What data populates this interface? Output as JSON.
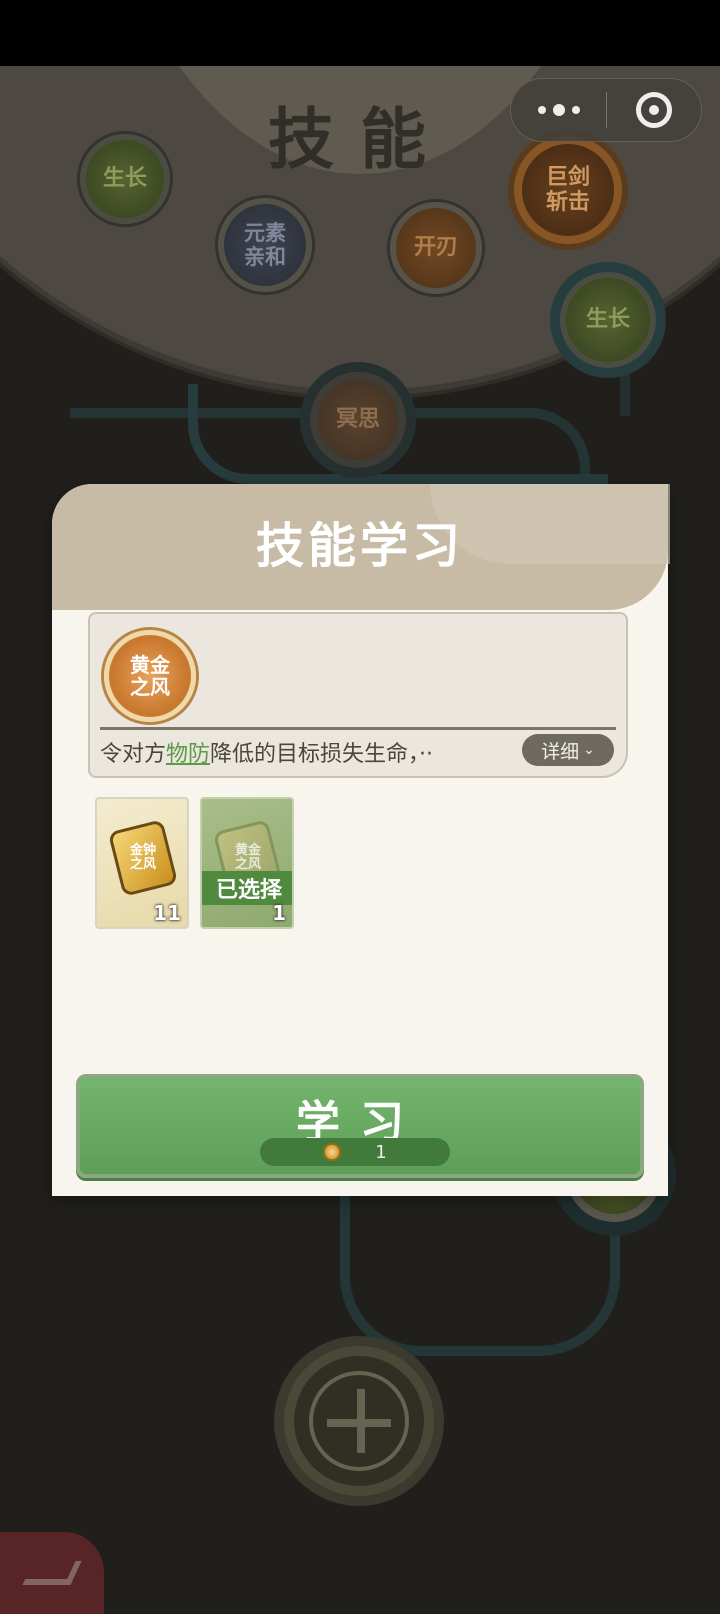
{
  "page": {
    "title": "技能"
  },
  "capsule": {
    "more_icon": "more-dots-icon",
    "close_icon": "target-close-icon"
  },
  "skill_tree": {
    "nodes": [
      {
        "id": "growth-top",
        "label": "生长"
      },
      {
        "id": "element-affinity",
        "label": "元素亲和"
      },
      {
        "id": "sharpen",
        "label": "开刃"
      },
      {
        "id": "giant-sword-slash",
        "label": "巨剑斩击"
      },
      {
        "id": "growth-right",
        "label": "生长"
      },
      {
        "id": "meditation",
        "label": "冥思"
      }
    ]
  },
  "modal": {
    "title": "技能学习",
    "skill": {
      "name": "黄金之风",
      "desc_pre": "令对方",
      "desc_keyword": "物防",
      "desc_post": "降低的目标损失生命，··",
      "detail_label": "详细"
    },
    "items": [
      {
        "name": "金钟之风",
        "count": "11",
        "selected": false
      },
      {
        "name": "黄金之风",
        "count": "1",
        "selected": true,
        "selected_label": "已选择"
      }
    ],
    "learn_button": {
      "label": "学习",
      "cost": "1",
      "cost_icon": "coin-icon"
    }
  },
  "colors": {
    "accent_green": "#5d9f58",
    "panel_bg": "#f8f5ef",
    "header_bg": "#c7bba6"
  }
}
